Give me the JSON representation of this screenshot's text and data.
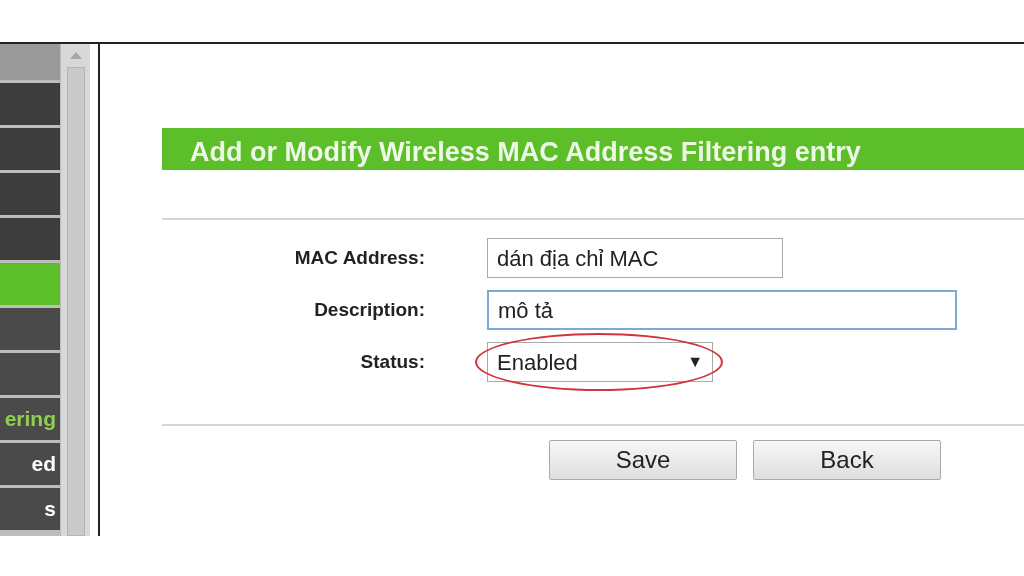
{
  "sidebar": {
    "items": [
      {
        "kind": "header",
        "selected": false
      },
      {
        "kind": "menu",
        "selected": false
      },
      {
        "kind": "menu",
        "selected": false
      },
      {
        "kind": "menu",
        "selected": false
      },
      {
        "kind": "menu",
        "selected": false
      },
      {
        "kind": "menu",
        "selected": true
      },
      {
        "kind": "submenu",
        "selected": false
      },
      {
        "kind": "submenu",
        "selected": false
      },
      {
        "kind": "submenu",
        "label": "ering",
        "selected": false,
        "current": true
      },
      {
        "kind": "submenu",
        "label": "ed",
        "selected": false,
        "current": false
      },
      {
        "kind": "submenu",
        "label": "s",
        "selected": false,
        "current": false
      }
    ]
  },
  "panel": {
    "title": "Add or Modify Wireless MAC Address Filtering entry",
    "fields": [
      {
        "kind": "text",
        "label": "MAC Address:",
        "value": "dán địa chỉ MAC",
        "wide": false,
        "focused": false,
        "circled": false
      },
      {
        "kind": "text",
        "label": "Description:",
        "value": "mô tả",
        "wide": true,
        "focused": true,
        "circled": false
      },
      {
        "kind": "select",
        "label": "Status:",
        "value": "Enabled",
        "caret": "▼",
        "wide": false,
        "focused": false,
        "circled": true
      }
    ],
    "buttons": [
      "Save",
      "Back"
    ]
  }
}
